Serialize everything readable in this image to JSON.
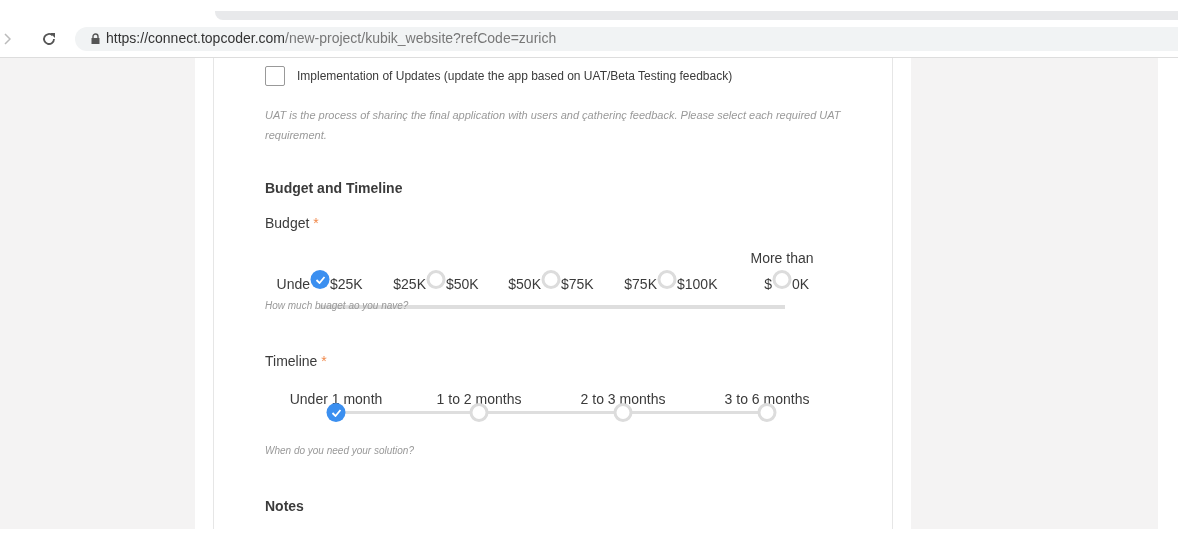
{
  "browser": {
    "url_host": "https://connect.topcoder.com",
    "url_path": "/new-project/kubik_website?refCode=zurich"
  },
  "uat": {
    "checkbox": {
      "label": "Implementation of Updates (update the app based on UAT/Beta Testing feedback)",
      "checked": false
    },
    "help": "UAT is the process of sharinç the final application with users and çatherinç feedback. Please select each required UAT requirement."
  },
  "section_title": "Budget and Timeline",
  "budget": {
    "label": "Budget",
    "required": "*",
    "options": [
      {
        "left": "Unde",
        "right": "$25K",
        "selected": true
      },
      {
        "left": "$25K",
        "right": "$50K",
        "selected": false
      },
      {
        "left": "$50K",
        "right": "$75K",
        "selected": false
      },
      {
        "left": "$75K",
        "right": "$100K",
        "selected": false
      },
      {
        "top": "More than",
        "left": "$",
        "right": "0K",
        "selected": false
      }
    ],
    "help": "How much buaget ao you nave?"
  },
  "timeline": {
    "label": "Timeline",
    "required": "*",
    "options": [
      {
        "label": "Under 1 month",
        "selected": true
      },
      {
        "label": "1 to 2 months",
        "selected": false
      },
      {
        "label": "2 to 3 months",
        "selected": false
      },
      {
        "label": "3 to 6 months",
        "selected": false
      }
    ],
    "help": "When do you need your solution?"
  },
  "notes_title": "Notes"
}
